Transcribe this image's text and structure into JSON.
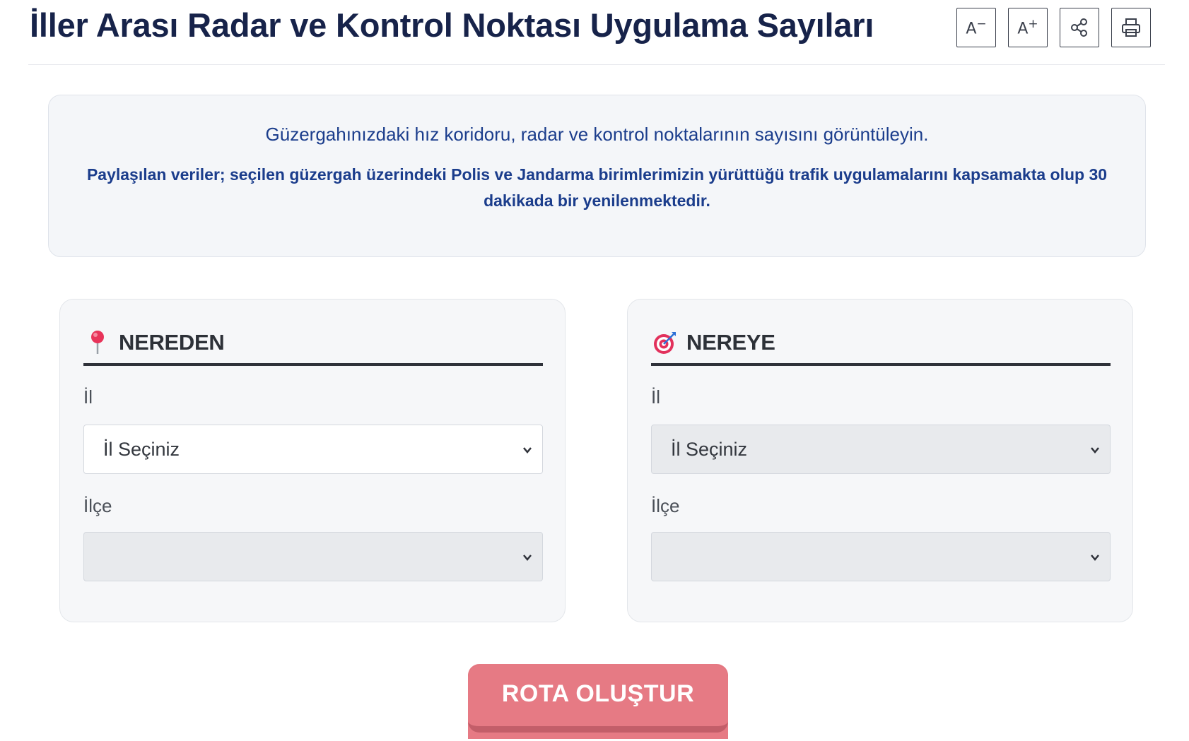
{
  "header": {
    "title": "İller Arası Radar ve Kontrol Noktası Uygulama Sayıları",
    "tools": [
      {
        "name": "font-decrease",
        "label": "A",
        "sup": "−"
      },
      {
        "name": "font-increase",
        "label": "A",
        "sup": "+"
      },
      {
        "name": "share",
        "icon": "share-icon"
      },
      {
        "name": "print",
        "icon": "printer-icon"
      }
    ]
  },
  "info": {
    "main": "Güzergahınızdaki hız koridoru, radar ve kontrol noktalarının sayısını görüntüleyin.",
    "sub": "Paylaşılan veriler; seçilen güzergah üzerindeki Polis ve Jandarma birimlerimizin yürüttüğü trafik uygulamalarını kapsamakta olup 30 dakikada bir yenilenmektedir."
  },
  "from": {
    "title": "NEREDEN",
    "icon": "pushpin-icon",
    "il_label": "İl",
    "il_value": "İl Seçiniz",
    "ilce_label": "İlçe",
    "ilce_value": ""
  },
  "to": {
    "title": "NEREYE",
    "icon": "target-icon",
    "il_label": "İl",
    "il_value": "İl Seçiniz",
    "ilce_label": "İlçe",
    "ilce_value": ""
  },
  "action": {
    "route_label": "ROTA OLUŞTUR"
  },
  "colors": {
    "title": "#17234a",
    "info_text": "#1b3d8c",
    "button": "#e67a84",
    "button_shadow": "#c35e69"
  }
}
